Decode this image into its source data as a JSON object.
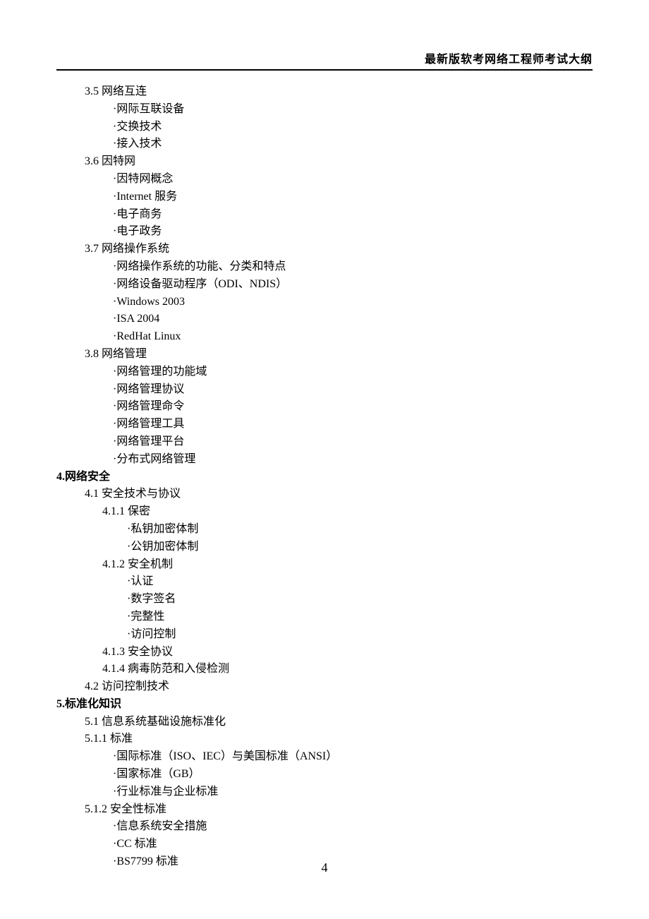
{
  "header": "最新版软考网络工程师考试大纲",
  "rows": [
    {
      "cls": "l2",
      "t": "3.5 网络互连"
    },
    {
      "cls": "l3",
      "t": "·网际互联设备"
    },
    {
      "cls": "l3",
      "t": "·交换技术"
    },
    {
      "cls": "l3",
      "t": "·接入技术"
    },
    {
      "cls": "l2",
      "t": "3.6 因特网"
    },
    {
      "cls": "l3",
      "t": "·因特网概念"
    },
    {
      "cls": "l3",
      "t": "·Internet 服务"
    },
    {
      "cls": "l3",
      "t": "·电子商务"
    },
    {
      "cls": "l3",
      "t": "·电子政务"
    },
    {
      "cls": "l2",
      "t": "3.7 网络操作系统"
    },
    {
      "cls": "l3",
      "t": "·网络操作系统的功能、分类和特点"
    },
    {
      "cls": "l3",
      "t": "·网络设备驱动程序（ODI、NDIS）"
    },
    {
      "cls": "l3",
      "t": "·Windows 2003"
    },
    {
      "cls": "l3",
      "t": "·ISA 2004"
    },
    {
      "cls": "l3",
      "t": "·RedHat Linux"
    },
    {
      "cls": "l2",
      "t": "3.8 网络管理"
    },
    {
      "cls": "l3",
      "t": "·网络管理的功能域"
    },
    {
      "cls": "l3",
      "t": "·网络管理协议"
    },
    {
      "cls": "l3",
      "t": "·网络管理命令"
    },
    {
      "cls": "l3",
      "t": "·网络管理工具"
    },
    {
      "cls": "l3",
      "t": "·网络管理平台"
    },
    {
      "cls": "l3",
      "t": "·分布式网络管理"
    },
    {
      "cls": "h1",
      "t": "4.网络安全"
    },
    {
      "cls": "l2",
      "t": "4.1 安全技术与协议"
    },
    {
      "cls": "l4",
      "t": "4.1.1 保密"
    },
    {
      "cls": "l4b",
      "t": "·私钥加密体制"
    },
    {
      "cls": "l4b",
      "t": "·公钥加密体制"
    },
    {
      "cls": "l4",
      "t": "4.1.2 安全机制"
    },
    {
      "cls": "l4b",
      "t": "·认证"
    },
    {
      "cls": "l4b",
      "t": "·数字签名"
    },
    {
      "cls": "l4b",
      "t": "·完整性"
    },
    {
      "cls": "l4b",
      "t": "·访问控制"
    },
    {
      "cls": "l4",
      "t": "4.1.3 安全协议"
    },
    {
      "cls": "l4",
      "t": "4.1.4 病毒防范和入侵检测"
    },
    {
      "cls": "l2",
      "t": "4.2 访问控制技术"
    },
    {
      "cls": "h1",
      "t": "5.标准化知识"
    },
    {
      "cls": "l2",
      "t": "5.1 信息系统基础设施标准化"
    },
    {
      "cls": "l2",
      "t": "5.1.1 标准"
    },
    {
      "cls": "l3",
      "t": "·国际标准（ISO、IEC）与美国标准（ANSI）"
    },
    {
      "cls": "l3",
      "t": "·国家标准（GB）"
    },
    {
      "cls": "l3",
      "t": "·行业标准与企业标准"
    },
    {
      "cls": "l2",
      "t": "5.1.2 安全性标准"
    },
    {
      "cls": "l3",
      "t": "·信息系统安全措施"
    },
    {
      "cls": "l3",
      "t": "·CC 标准"
    },
    {
      "cls": "l3",
      "t": "·BS7799 标准"
    }
  ],
  "page_number": "4"
}
